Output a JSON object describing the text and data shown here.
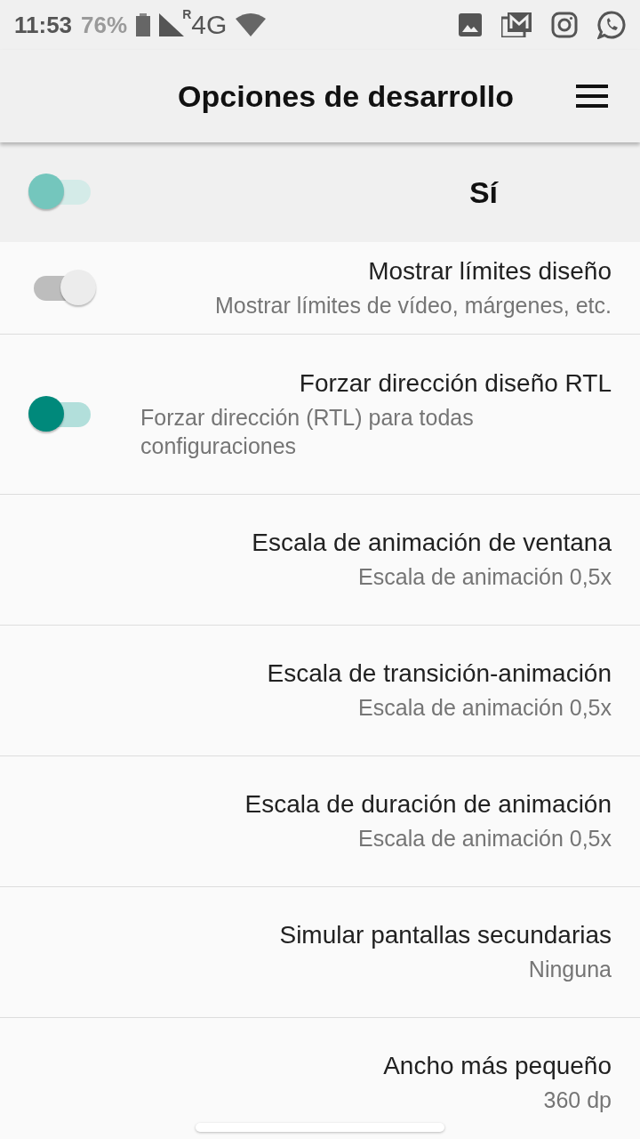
{
  "status_bar": {
    "time": "11:53",
    "battery": "76%",
    "roaming": "R",
    "network": "4G"
  },
  "app_bar": {
    "title": "Opciones de desarrollo"
  },
  "master": {
    "label": "Sí",
    "on": true
  },
  "settings": [
    {
      "kind": "switch",
      "title": "Mostrar límites diseño",
      "summary": "Mostrar límites de vídeo, márgenes, etc.",
      "on": false
    },
    {
      "kind": "switch",
      "title": "Forzar dirección diseño RTL",
      "summary": "Forzar dirección (RTL) para todas configuraciones",
      "on": true
    },
    {
      "kind": "value",
      "title": "Escala de animación de ventana",
      "summary": "Escala de animación 0,5x"
    },
    {
      "kind": "value",
      "title": "Escala de transición-animación",
      "summary": "Escala de animación 0,5x"
    },
    {
      "kind": "value",
      "title": "Escala de duración de animación",
      "summary": "Escala de animación 0,5x"
    },
    {
      "kind": "value",
      "title": "Simular pantallas secundarias",
      "summary": "Ninguna"
    },
    {
      "kind": "value",
      "title": "Ancho más pequeño",
      "summary": "360 dp"
    }
  ]
}
